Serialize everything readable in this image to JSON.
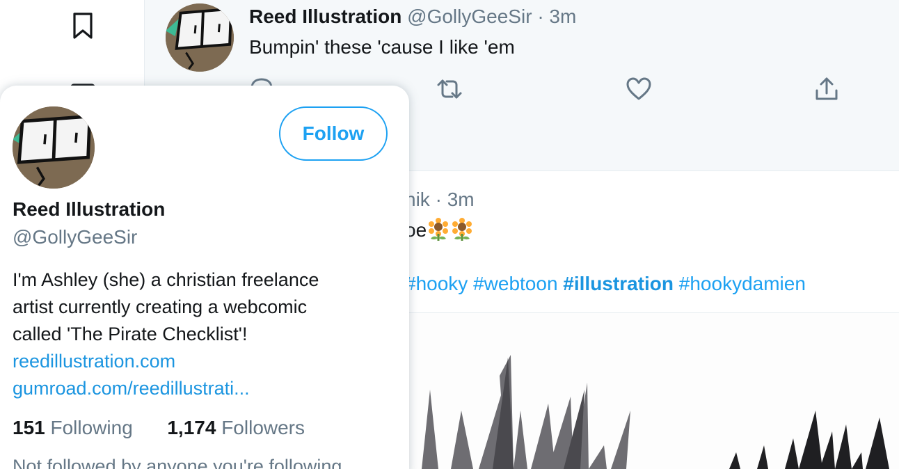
{
  "tweet1": {
    "name": "Reed Illustration",
    "handle": "@GollyGeeSir",
    "sep": "·",
    "time": "3m",
    "text": "Bumpin' these 'cause I like 'em"
  },
  "tweet2": {
    "handle_fragment": "nik",
    "sep": "·",
    "time": "3m",
    "text_fragment": "oe",
    "tags": [
      "#hooky",
      "#webtoon",
      "#illustration",
      "#hookydamien"
    ]
  },
  "card": {
    "follow_label": "Follow",
    "name": "Reed Illustration",
    "handle": "@GollyGeeSir",
    "bio_lines": [
      "I'm Ashley (she) a christian freelance",
      "artist currently creating a webcomic",
      "called 'The Pirate Checklist'!"
    ],
    "links": [
      "reedillustration.com",
      "gumroad.com/reedillustrati..."
    ],
    "following_count": "151",
    "following_label": "Following",
    "followers_count": "1,174",
    "followers_label": "Followers",
    "note": "Not followed by anyone you're following"
  },
  "colors": {
    "accent": "#1da1f2",
    "muted": "#657786",
    "hover_bg": "#f5f8fa"
  },
  "icons": {
    "nav": [
      "bookmark-icon",
      "list-icon"
    ],
    "actions": [
      "reply-icon",
      "retweet-icon",
      "like-icon",
      "share-icon"
    ]
  }
}
